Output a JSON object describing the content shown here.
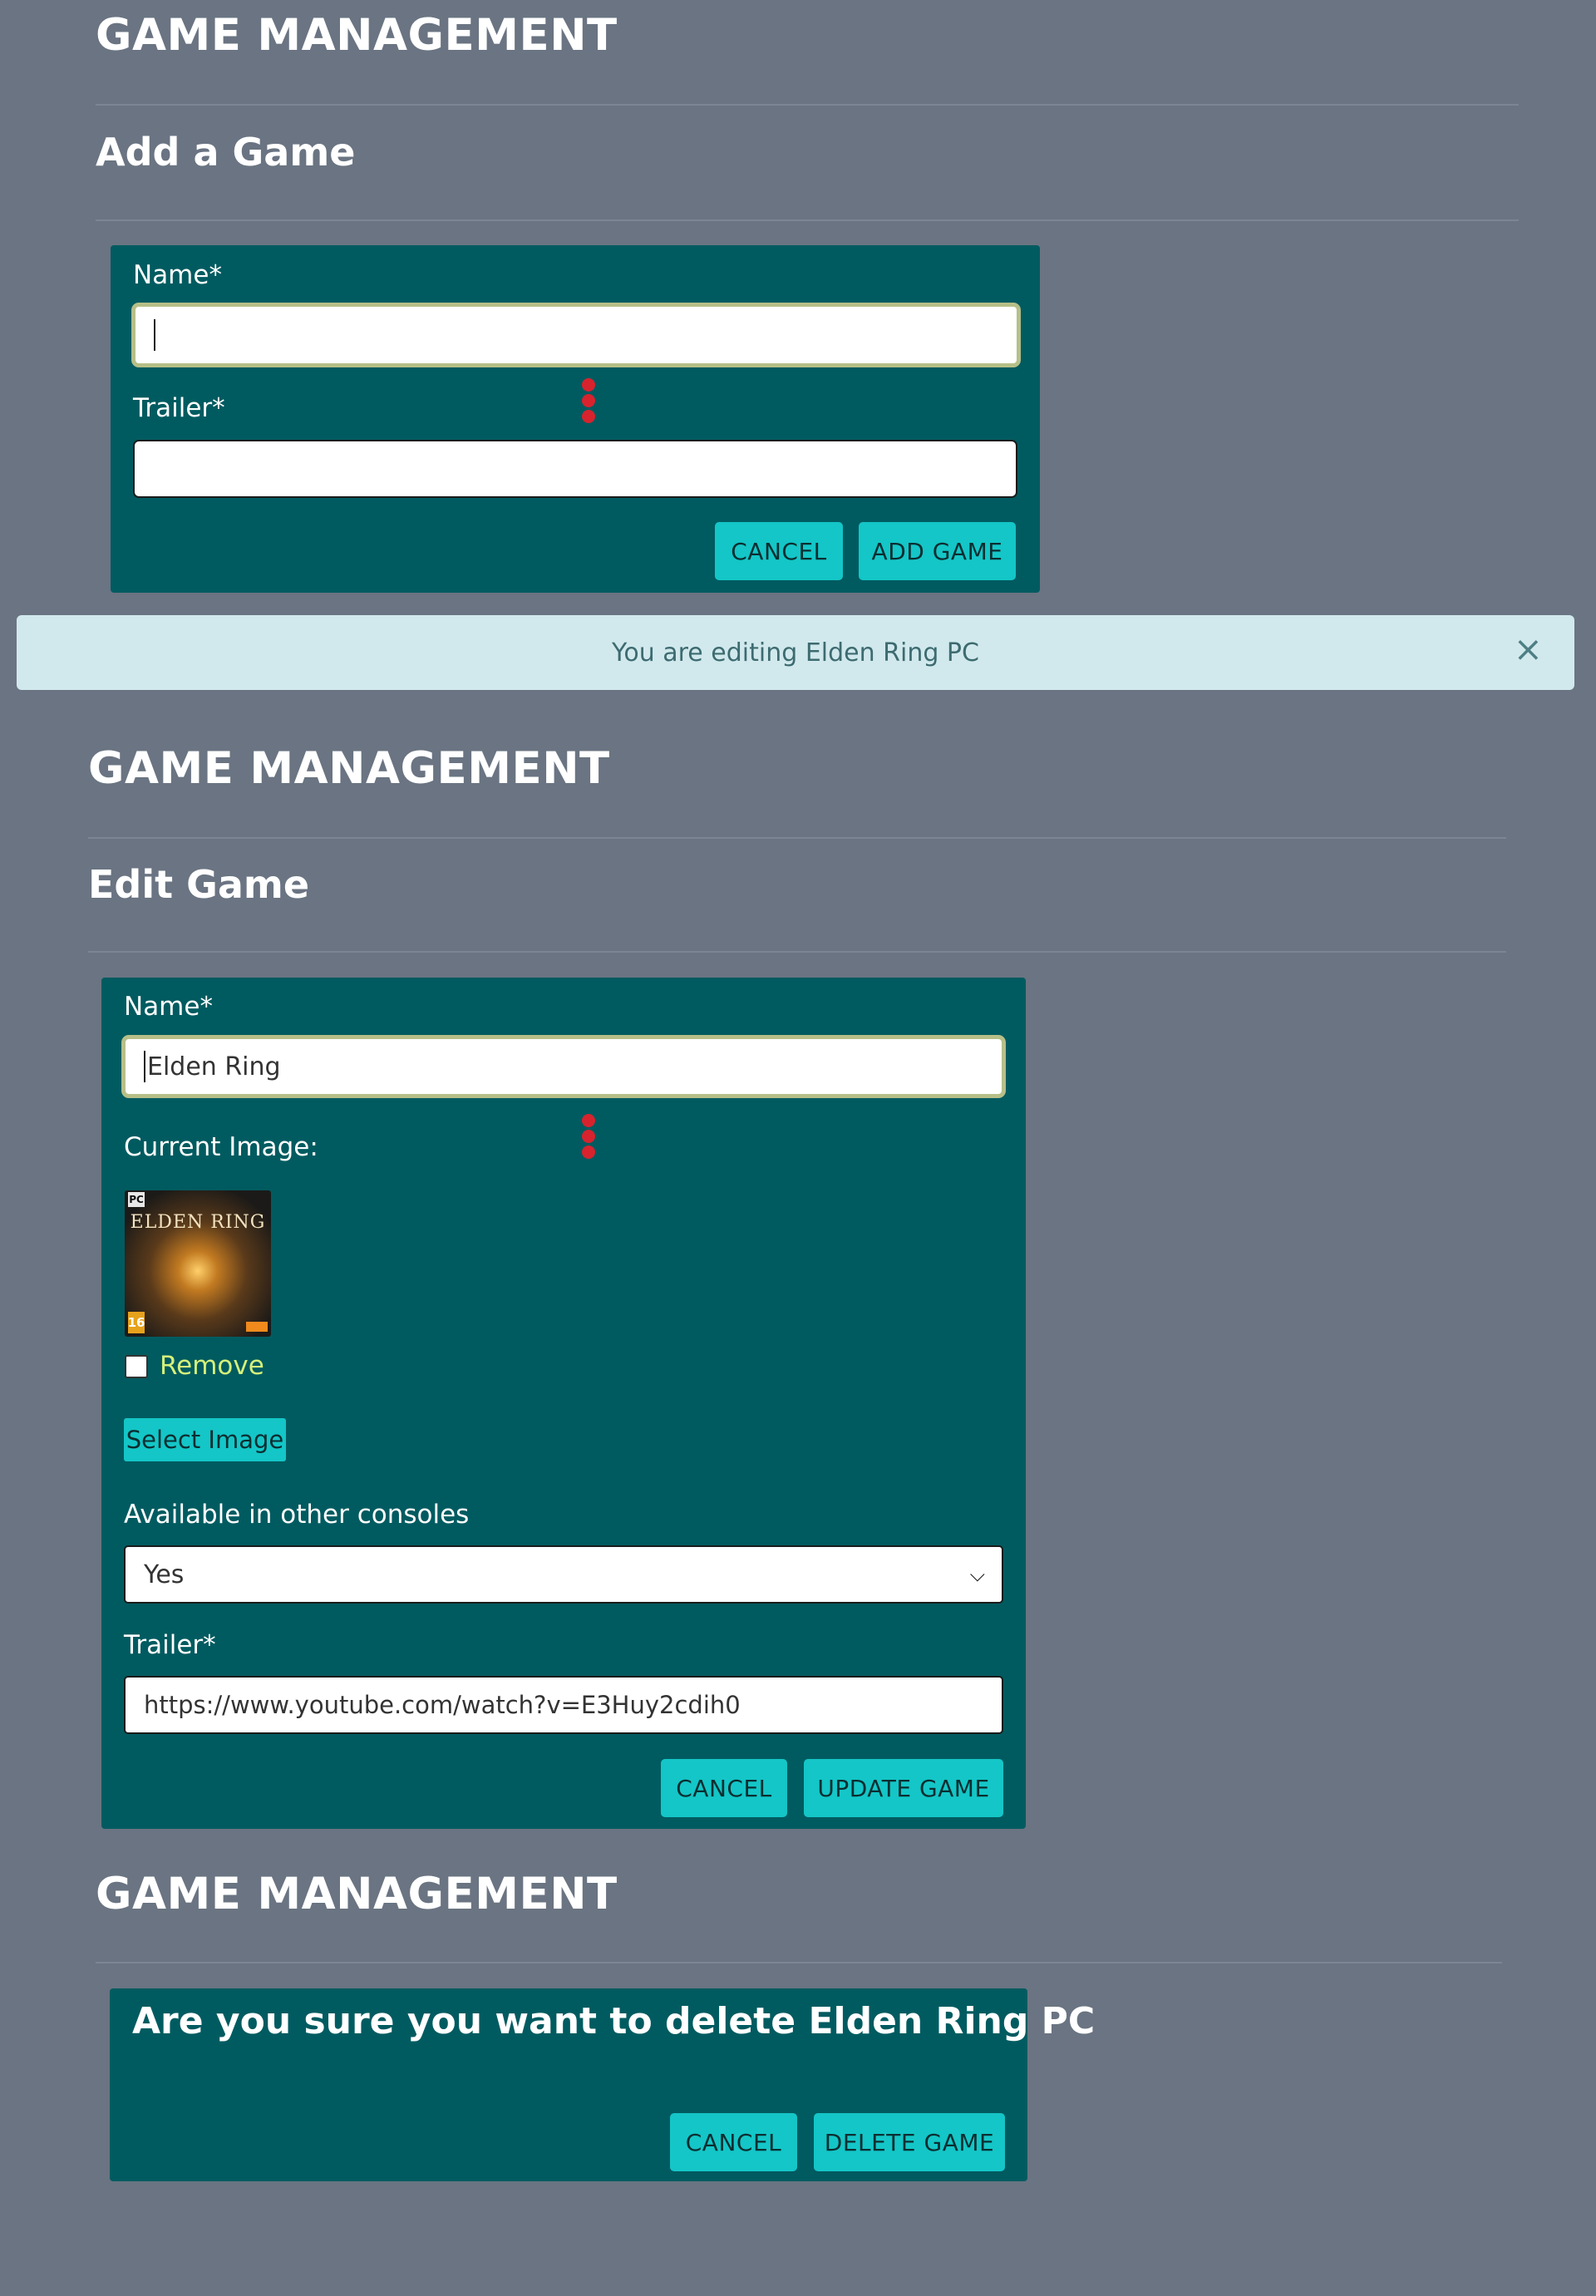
{
  "add_section": {
    "page_heading": "GAME MANAGEMENT",
    "form_heading": "Add a Game",
    "name_label": "Name*",
    "name_value": "",
    "trailer_label": "Trailer*",
    "trailer_value": "",
    "cancel_label": "CANCEL",
    "submit_label": "ADD GAME"
  },
  "alert": {
    "message": "You are editing Elden Ring PC",
    "close_glyph": "×"
  },
  "edit_section": {
    "page_heading": "GAME MANAGEMENT",
    "form_heading": "Edit Game",
    "name_label": "Name*",
    "name_value": "Elden Ring",
    "current_image_label": "Current Image:",
    "image_title_text": "ELDEN RING",
    "image_rating_text": "16",
    "image_platform_text": "PC",
    "remove_label": "Remove",
    "remove_checked": false,
    "select_image_label": "Select Image",
    "consoles_label": "Available in other consoles",
    "consoles_value": "Yes",
    "trailer_label": "Trailer*",
    "trailer_value": "https://www.youtube.com/watch?v=E3Huy2cdih0",
    "cancel_label": "CANCEL",
    "submit_label": "UPDATE GAME"
  },
  "delete_section": {
    "page_heading": "GAME MANAGEMENT",
    "confirm_text": "Are you sure you want to delete Elden Ring PC",
    "cancel_label": "CANCEL",
    "submit_label": "DELETE GAME"
  },
  "icons": {
    "drag_handle": "drag-handle-icon",
    "close": "close-icon",
    "dropdown": "chevron-down-icon"
  },
  "colors": {
    "page_background": "#6a7482",
    "panel_background": "#005b60",
    "button_background": "#14c6c7",
    "alert_background": "#d1e9ed",
    "remove_text": "#d5f07b",
    "drag_handle": "#d7232e"
  }
}
